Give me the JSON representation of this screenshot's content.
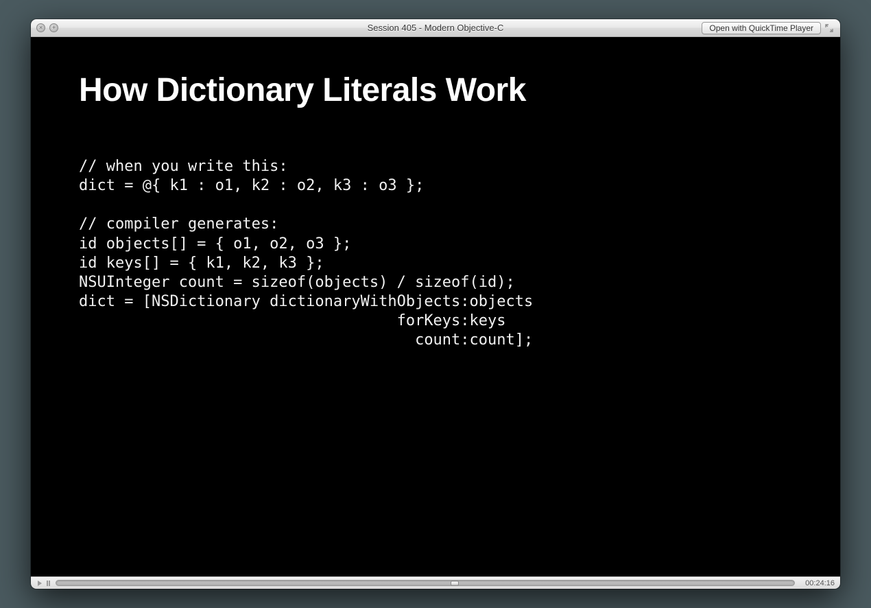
{
  "window": {
    "title": "Session 405 - Modern Objective-C",
    "open_with_label": "Open with QuickTime Player"
  },
  "slide": {
    "title": "How Dictionary Literals Work",
    "code": "// when you write this:\ndict = @{ k1 : o1, k2 : o2, k3 : o3 };\n\n// compiler generates:\nid objects[] = { o1, o2, o3 };\nid keys[] = { k1, k2, k3 };\nNSUInteger count = sizeof(objects) / sizeof(id);\ndict = [NSDictionary dictionaryWithObjects:objects\n                                   forKeys:keys\n                                     count:count];"
  },
  "player": {
    "timecode": "00:24:16"
  }
}
